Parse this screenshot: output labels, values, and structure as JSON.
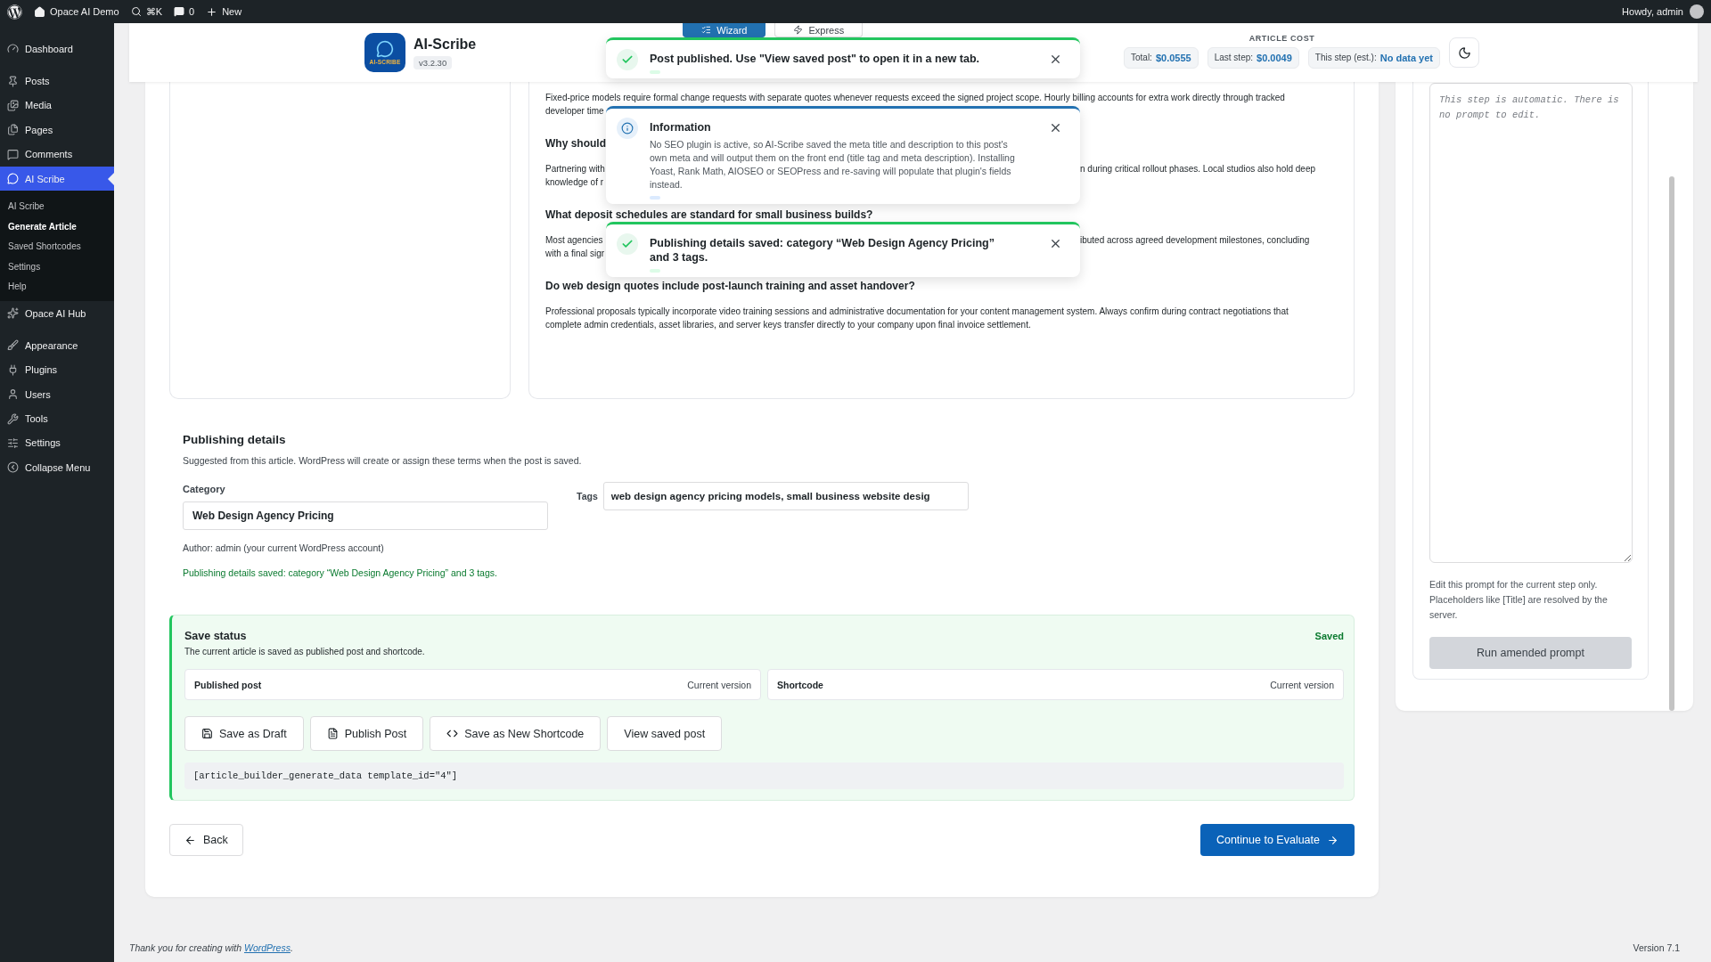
{
  "admin_bar": {
    "site": "Opace AI Demo",
    "search_shortcut": "⌘K",
    "comments": "0",
    "new": "New",
    "greeting": "Howdy, admin"
  },
  "sidebar": {
    "groups": [
      {
        "items": [
          {
            "label": "Dashboard",
            "selected": false
          }
        ]
      },
      {
        "items": [
          {
            "label": "Posts",
            "selected": false
          },
          {
            "label": "Media",
            "selected": false
          },
          {
            "label": "Pages",
            "selected": false
          },
          {
            "label": "Comments",
            "selected": false
          },
          {
            "label": "AI Scribe",
            "selected": true,
            "children": [
              {
                "label": "AI Scribe",
                "selected": false
              },
              {
                "label": "Generate Article",
                "selected": true
              },
              {
                "label": "Saved Shortcodes",
                "selected": false
              },
              {
                "label": "Settings",
                "selected": false
              },
              {
                "label": "Help",
                "selected": false
              }
            ]
          },
          {
            "label": "Opace AI Hub",
            "selected": false
          }
        ]
      },
      {
        "items": [
          {
            "label": "Appearance",
            "selected": false
          },
          {
            "label": "Plugins",
            "selected": false
          },
          {
            "label": "Users",
            "selected": false
          },
          {
            "label": "Tools",
            "selected": false
          },
          {
            "label": "Settings",
            "selected": false
          },
          {
            "label": "Collapse Menu",
            "selected": false
          }
        ]
      }
    ]
  },
  "header": {
    "logo_text": "AI-SCRIBE",
    "title": "AI-Scribe",
    "version": "v3.2.30",
    "modes": [
      {
        "label": "Wizard",
        "selected": true
      },
      {
        "label": "Express",
        "selected": false
      }
    ],
    "cost": {
      "heading": "ARTICLE COST",
      "chips": [
        {
          "label": "Total:",
          "value": "$0.0555"
        },
        {
          "label": "Last step:",
          "value": "$0.0049"
        },
        {
          "label": "This step (est.):",
          "value": "No data yet"
        }
      ]
    }
  },
  "toasts": [
    {
      "kind": "success",
      "title": "Post published. Use \"View saved post\" to open it in a new tab."
    },
    {
      "kind": "info",
      "title": "Information",
      "body": "No SEO plugin is active, so AI-Scribe saved the meta title and description to this post's own meta and will output them on the front end (title tag and meta description). Installing Yoast, Rank Math, AIOSEO or SEOPress and re-saving will populate that plugin's fields instead."
    },
    {
      "kind": "success",
      "title": "Publishing details saved: category “Web Design Agency Pricing” and 3 tags."
    }
  ],
  "article": {
    "blocks": [
      {
        "kind": "paragraph",
        "lines": [
          {
            "kind": "full",
            "text": "Fixed-price models require formal change requests with separate quotes whenever requests exceed the signed project scope. Hourly billing accounts for extra work directly through tracked"
          },
          {
            "kind": "left",
            "left": "developer time"
          }
        ]
      },
      {
        "kind": "heading",
        "lines": [
          {
            "kind": "left",
            "left": "Why should"
          }
        ]
      },
      {
        "kind": "paragraph",
        "lines": [
          {
            "kind": "split",
            "left": "Partnering with",
            "right": "n during critical rollout phases. Local studios also hold deep"
          },
          {
            "kind": "left",
            "left": "knowledge of r"
          }
        ]
      },
      {
        "kind": "heading",
        "lines": [
          {
            "kind": "full",
            "text": "What deposit schedules are standard for small business builds?"
          }
        ]
      },
      {
        "kind": "paragraph",
        "lines": [
          {
            "kind": "split",
            "left": "Most agencies",
            "right": "ibuted across agreed development milestones, concluding"
          },
          {
            "kind": "left",
            "left": "with a final sigr"
          }
        ]
      },
      {
        "kind": "heading",
        "lines": [
          {
            "kind": "full",
            "text": "Do web design quotes include post-launch training and asset handover?"
          }
        ]
      },
      {
        "kind": "paragraph",
        "lines": [
          {
            "kind": "full",
            "text": "Professional proposals typically incorporate video training sessions and administrative documentation for your content management system. Always confirm during contract negotiations that"
          },
          {
            "kind": "full",
            "text": "complete admin credentials, asset libraries, and server keys transfer directly to your company upon final invoice settlement."
          }
        ]
      }
    ]
  },
  "publishing": {
    "title": "Publishing details",
    "subtitle": "Suggested from this article. WordPress will create or assign these terms when the post is saved.",
    "category_label": "Category",
    "category_value": "Web Design Agency Pricing",
    "tags_label": "Tags",
    "tags_value": "web design agency pricing models, small business website desig",
    "author": "Author: admin (your current WordPress account)",
    "saved_message": "Publishing details saved: category “Web Design Agency Pricing” and 3 tags."
  },
  "save_status": {
    "title": "Save status",
    "description": "The current article is saved as published post and shortcode.",
    "state": "Saved",
    "items": [
      {
        "label": "Published post",
        "status": "Current version"
      },
      {
        "label": "Shortcode",
        "status": "Current version"
      }
    ],
    "actions": [
      {
        "label": "Save as Draft"
      },
      {
        "label": "Publish Post"
      },
      {
        "label": "Save as New Shortcode"
      },
      {
        "label": "View saved post"
      }
    ],
    "shortcode": "[article_builder_generate_data template_id=\"4\"]"
  },
  "nav": {
    "back": "Back",
    "continue": "Continue to Evaluate"
  },
  "prompt_panel": {
    "placeholder": "This step is automatic. There is no prompt to edit.",
    "help": "Edit this prompt for the current step only. Placeholders like [Title] are resolved by the server.",
    "button": {
      "label": "Run amended prompt",
      "disabled": true
    }
  },
  "footer": {
    "credit": "Thank you for creating with ",
    "credit_link": "WordPress",
    "credit_end": ".",
    "version": "Version 7.1"
  }
}
